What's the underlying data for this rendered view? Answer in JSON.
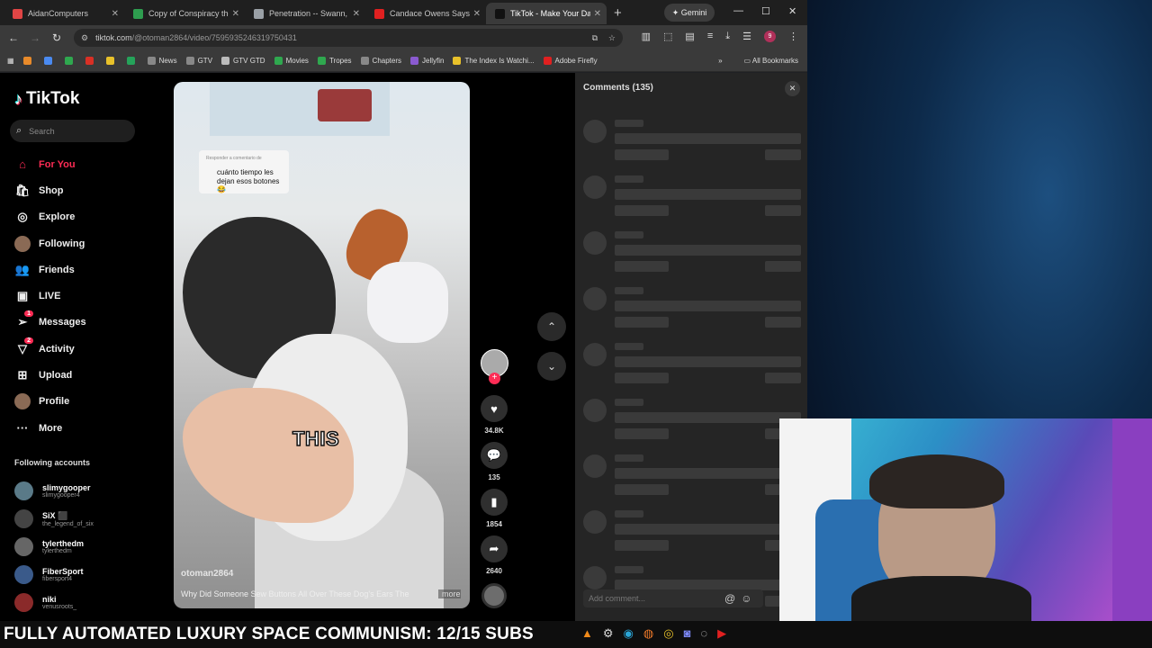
{
  "browser": {
    "tabs": [
      {
        "label": "AidanComputers",
        "color": "#e04545",
        "active": false
      },
      {
        "label": "Copy of Conspiracy theo",
        "color": "#2e9d4f",
        "active": false
      },
      {
        "label": "Penetration -- Swann, In",
        "color": "#9aa0a6",
        "active": false
      },
      {
        "label": "Candace Owens Says Ch",
        "color": "#e02020",
        "active": false
      },
      {
        "label": "TikTok - Make Your Day",
        "color": "#111111",
        "active": true
      }
    ],
    "new_tab": "+",
    "gemini_label": "Gemini",
    "url_host": "tiktok.com",
    "url_path": "/@otoman2864/video/7595935246319750431",
    "profile_initial": "9",
    "bookmarks": [
      "News",
      "GTV",
      "GTV GTD",
      "Movies",
      "Tropes",
      "Chapters",
      "Jellyfin",
      "The Index Is Watchi...",
      "Adobe Firefly"
    ],
    "bookmarks_overflow": "»",
    "all_bookmarks": "All Bookmarks"
  },
  "tiktok": {
    "brand": "TikTok",
    "search_placeholder": "Search",
    "menu": [
      {
        "label": "For You",
        "icon": "home-icon",
        "glyph": "⌂",
        "active": true
      },
      {
        "label": "Shop",
        "icon": "shop-icon",
        "glyph": "🛍"
      },
      {
        "label": "Explore",
        "icon": "compass-icon",
        "glyph": "◎"
      },
      {
        "label": "Following",
        "icon": "avatar-icon",
        "glyph": ""
      },
      {
        "label": "Friends",
        "icon": "friends-icon",
        "glyph": "👥"
      },
      {
        "label": "LIVE",
        "icon": "live-icon",
        "glyph": "▣"
      },
      {
        "label": "Messages",
        "icon": "messages-icon",
        "glyph": "➢",
        "badge": "1"
      },
      {
        "label": "Activity",
        "icon": "activity-icon",
        "glyph": "▽",
        "badge": "2"
      },
      {
        "label": "Upload",
        "icon": "upload-icon",
        "glyph": "⊞"
      },
      {
        "label": "Profile",
        "icon": "profile-icon",
        "glyph": ""
      },
      {
        "label": "More",
        "icon": "more-icon",
        "glyph": "···"
      }
    ],
    "following_heading": "Following accounts",
    "following": [
      {
        "name": "slimygooper",
        "user": "slimygooper4",
        "color": "#5a7a88"
      },
      {
        "name": "SiX ⬛",
        "user": "the_legend_of_six",
        "color": "#444"
      },
      {
        "name": "tylerthedm",
        "user": "tylerthedm",
        "color": "#666"
      },
      {
        "name": "FiberSport",
        "user": "fibersport4",
        "color": "#3a5a8a"
      },
      {
        "name": "niki",
        "user": "venusroots_",
        "color": "#8a2a2a"
      }
    ],
    "video": {
      "reply_header": "Responder a comentario de",
      "reply_text": "cuánto tiempo les dejan esos botones😂",
      "caption_overlay": "THIS",
      "username": "otoman2864",
      "description": "Why Did Someone Sew Buttons All Over These Dog's Ears The",
      "more": "more"
    },
    "actions": {
      "likes": "34.8K",
      "comments": "135",
      "saves": "1854",
      "shares": "2640"
    },
    "comments_panel": {
      "title": "Comments",
      "count": "(135)",
      "add_placeholder": "Add comment..."
    }
  },
  "taskbar": {
    "ticker": "FULLY AUTOMATED LUXURY SPACE COMMUNISM: 12/15 SUBS"
  }
}
